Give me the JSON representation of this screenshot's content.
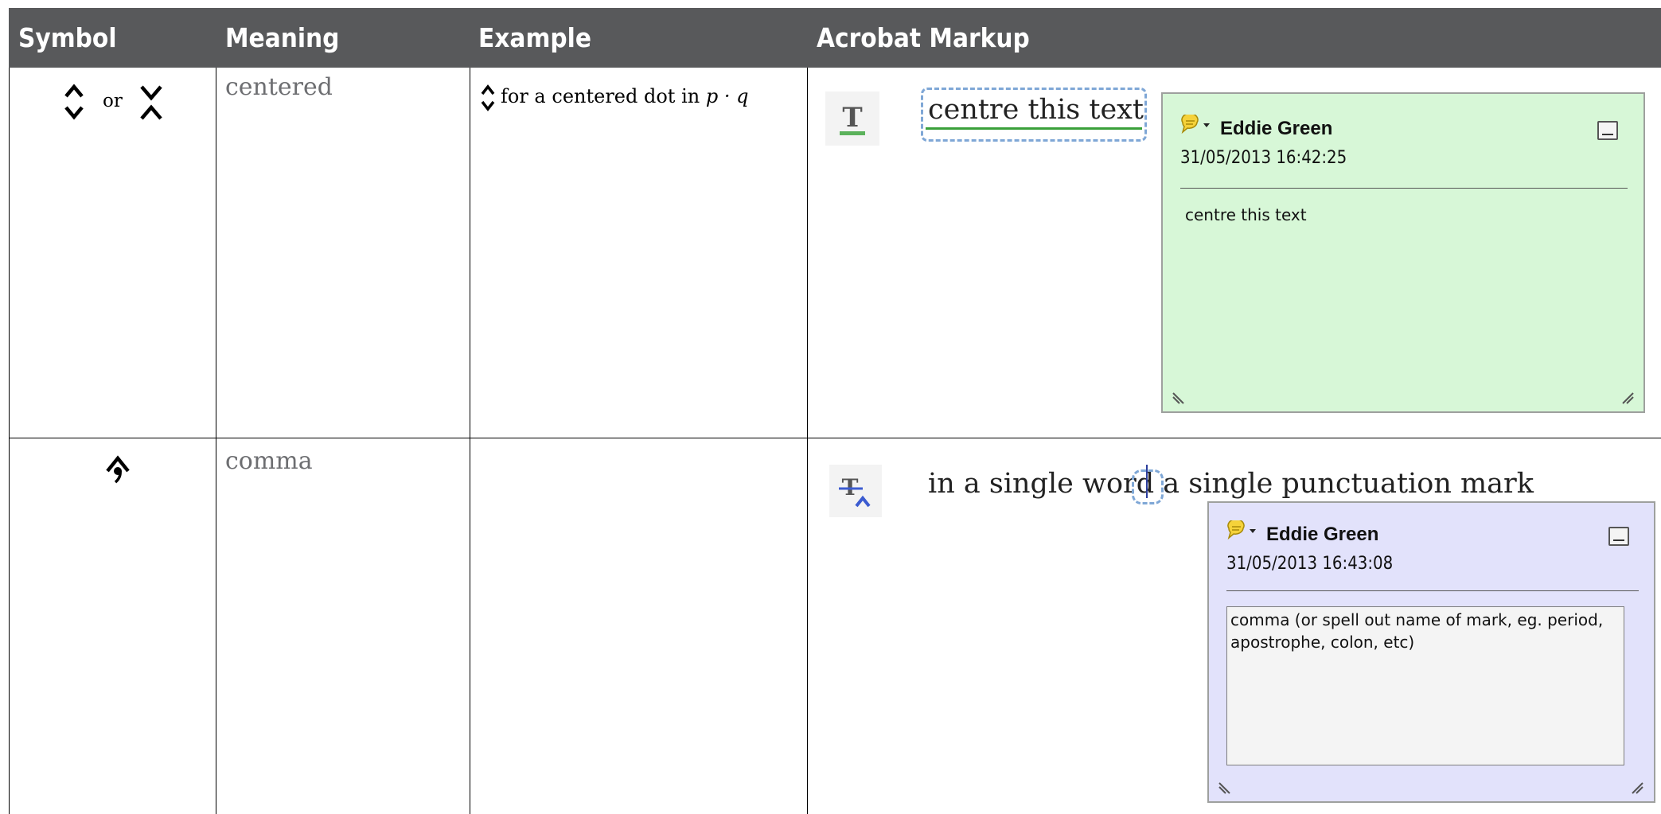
{
  "header": {
    "symbol": "Symbol",
    "meaning": "Meaning",
    "example": "Example",
    "acrobat": "Acrobat Markup"
  },
  "rows": [
    {
      "meaning": "centered",
      "symbol_or": "or",
      "example_text": "for a centered dot in",
      "example_math": "p · q",
      "doc_text": "centre this text",
      "note": {
        "author": "Eddie Green",
        "date": "31/05/2013 16:42:25",
        "body": "centre this text",
        "color": "#d7f7d7"
      }
    },
    {
      "meaning": "comma",
      "doc_text_before": "in a single wor",
      "doc_text_d": "d",
      "doc_text_after": "a single punctuation mark",
      "note": {
        "author": "Eddie Green",
        "date": "31/05/2013 16:43:08",
        "body": "comma (or spell out name of mark, eg. period, apostrophe, colon, etc)",
        "color": "#e2e2fb"
      }
    }
  ],
  "colors": {
    "header_bg": "#58595b",
    "meaning_text": "#6d6e71",
    "highlight_underline": "#3aa03a",
    "selection_dash": "#7fa7d6"
  },
  "icons": {
    "row1_symbol_a": "up-down-caret-icon",
    "row1_symbol_b": "chevrons-pointing-in-icon",
    "row2_symbol": "comma-caret-icon",
    "example_icon": "up-down-caret-icon",
    "tool1": "replace-text-tool-icon",
    "tool2": "insert-text-tool-icon",
    "note_icon": "speech-bubble-icon"
  }
}
